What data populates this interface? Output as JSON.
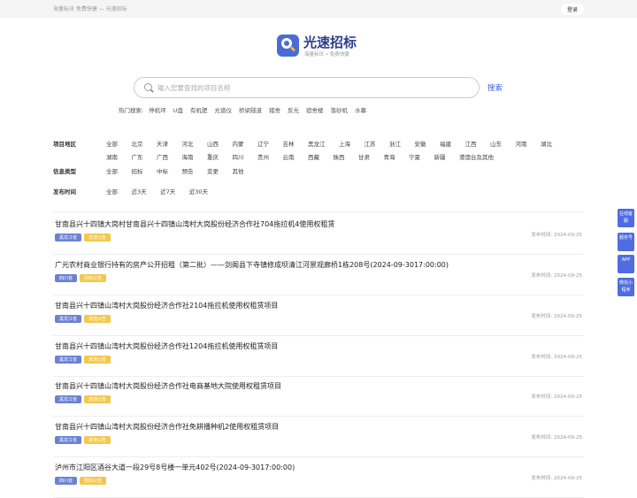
{
  "topbar": {
    "tagline": "海量标讯 免费快捷 — 光速招标",
    "login": "登录"
  },
  "logo": {
    "name": "光速招标",
    "slogan": "海量标讯 • 免费快捷"
  },
  "search": {
    "placeholder": "输入您要查找的项目名称",
    "button": "搜索"
  },
  "hot": {
    "label": "热门搜索:",
    "terms": [
      "停机坪",
      "U盘",
      "有机肥",
      "光谱仪",
      "桥梁隧道",
      "猪舍",
      "反光",
      "宿舍楼",
      "落砂机",
      "水幕"
    ]
  },
  "filters": {
    "region": {
      "label": "项目地区",
      "options": [
        "全部",
        "北京",
        "天津",
        "河北",
        "山西",
        "内蒙",
        "辽宁",
        "吉林",
        "黑龙江",
        "上海",
        "江苏",
        "浙江",
        "安徽",
        "福建",
        "江西",
        "山东",
        "河南",
        "湖北",
        "湖南",
        "广东",
        "广西",
        "海南",
        "重庆",
        "四川",
        "贵州",
        "云南",
        "西藏",
        "陕西",
        "甘肃",
        "青海",
        "宁夏",
        "新疆",
        "港澳台及其他"
      ]
    },
    "type": {
      "label": "信息类型",
      "options": [
        "全部",
        "招标",
        "中标",
        "预告",
        "变更",
        "其他"
      ]
    },
    "time": {
      "label": "发布时间",
      "options": [
        "全部",
        "近3天",
        "近7天",
        "近30天"
      ]
    }
  },
  "list": [
    {
      "title": "甘南县兴十四镇大岗村甘南县兴十四镇山湾村大岗股份经济合作社704拖拉机4使用权租赁",
      "region": "黑龙江省",
      "category": "其他公告",
      "date": "发布时间: 2024-09-25"
    },
    {
      "title": "广元农村商业银行持有的房产公开招租（第二批）——剑阁县下寺镇修成坝清江河景观廊桥1栋208号(2024-09-3017:00:00)",
      "region": "四川省",
      "category": "招标公告",
      "date": "发布时间: 2024-09-25"
    },
    {
      "title": "甘南县兴十四镇山湾村大岗股份经济合作社2104拖拉机使用权租赁项目",
      "region": "黑龙江省",
      "category": "其他公告",
      "date": "发布时间: 2024-09-25"
    },
    {
      "title": "甘南县兴十四镇山湾村大岗股份经济合作社1204拖拉机使用权租赁项目",
      "region": "黑龙江省",
      "category": "其他公告",
      "date": "发布时间: 2024-09-25"
    },
    {
      "title": "甘南县兴十四镇山湾村大岗股份经济合作社电商基地大院使用权租赁项目",
      "region": "黑龙江省",
      "category": "其他公告",
      "date": "发布时间: 2024-09-25"
    },
    {
      "title": "甘南县兴十四镇山湾村大岗股份经济合作社免耕播种机2使用权租赁项目",
      "region": "黑龙江省",
      "category": "其他公告",
      "date": "发布时间: 2024-09-25"
    },
    {
      "title": "泸州市江阳区酒谷大道一段29号8号楼一单元402号(2024-09-3017:00:00)",
      "region": "四川省",
      "category": "招标公告",
      "date": "发布时间: 2024-09-25"
    }
  ],
  "sidebar": [
    {
      "label": "在线客服"
    },
    {
      "label": "服务号"
    },
    {
      "label": "APP"
    },
    {
      "label": "微信小程序"
    }
  ]
}
